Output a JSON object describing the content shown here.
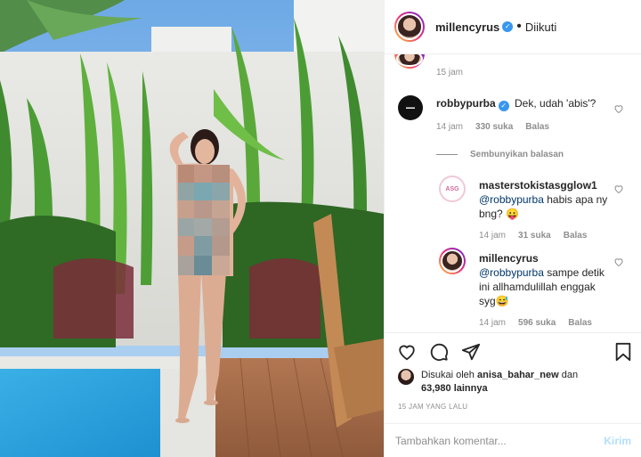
{
  "header": {
    "username": "millencyrus",
    "dot": "•",
    "follow_status": "Diikuti"
  },
  "comments": {
    "prev_time": "15 jam",
    "c1": {
      "username": "robbypurba",
      "text": "Dek, udah 'abis'?",
      "time": "14 jam",
      "likes": "330 suka",
      "reply": "Balas"
    },
    "hide_replies": "Sembunyikan balasan",
    "r1": {
      "username": "masterstokistasgglow1",
      "mention": "@robbypurba",
      "text": " habis apa ny bng? 😛",
      "time": "14 jam",
      "likes": "31 suka",
      "reply": "Balas"
    },
    "r2": {
      "username": "millencyrus",
      "mention": "@robbypurba",
      "text": " sampe detik ini allhamdulillah enggak syg😅",
      "time": "14 jam",
      "likes": "596 suka",
      "reply": "Balas"
    }
  },
  "likes": {
    "prefix": "Disukai oleh ",
    "user": "anisa_bahar_new",
    "mid": " dan",
    "count": "63,980 lainnya"
  },
  "time_ago": "15 JAM YANG LALU",
  "comment_input": {
    "placeholder": "Tambahkan komentar...",
    "send_label": "Kirim"
  },
  "colors": {
    "link": "#00376b",
    "verified": "#3897f0",
    "muted": "#8e8e8e",
    "send_disabled": "#b2dffc"
  }
}
